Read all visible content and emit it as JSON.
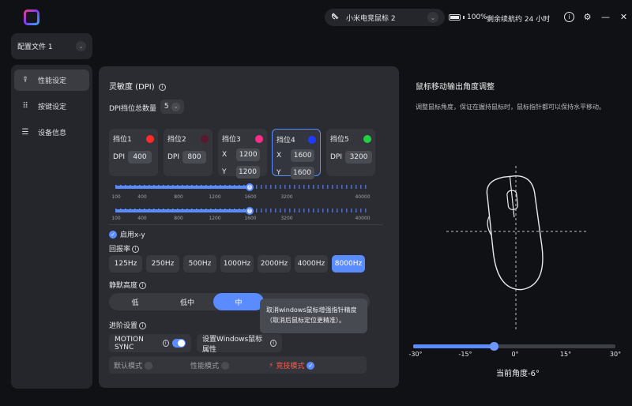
{
  "header": {
    "device_name": "小米电竞鼠标 2",
    "battery_pct": "100%",
    "battery_level": 1.0,
    "remaining": "剩余续航约 24 小时"
  },
  "profile": {
    "label": "配置文件 1"
  },
  "sidebar": {
    "items": [
      {
        "label": "性能设定",
        "icon": "performance-icon"
      },
      {
        "label": "按键设定",
        "icon": "keypad-icon"
      },
      {
        "label": "设备信息",
        "icon": "list-icon"
      }
    ]
  },
  "dpi": {
    "title": "灵敏度 (DPI)",
    "total_label": "DPI挡位总数量",
    "total": "5",
    "levels": [
      {
        "label": "挡位1",
        "color": "#ff2a2a",
        "mode": "single",
        "key": "DPI",
        "value": "400"
      },
      {
        "label": "挡位2",
        "color": "#5a1830",
        "mode": "single",
        "key": "DPI",
        "value": "800"
      },
      {
        "label": "挡位3",
        "color": "#ff2d8a",
        "mode": "xy",
        "x": "1200",
        "y": "1200"
      },
      {
        "label": "挡位4",
        "color": "#1f3bff",
        "mode": "xy",
        "x": "1600",
        "y": "1600",
        "selected": true
      },
      {
        "label": "挡位5",
        "color": "#20d040",
        "mode": "single",
        "key": "DPI",
        "value": "3200"
      }
    ],
    "x_label": "X",
    "y_label": "Y",
    "scale": [
      "100",
      "400",
      "800",
      "1200",
      "1600",
      "3200",
      "40000"
    ],
    "slider_x_mark": "X",
    "slider_y_mark": "Y",
    "enable_xy": "启用x-y"
  },
  "polling": {
    "title": "回报率",
    "options": [
      "125Hz",
      "250Hz",
      "500Hz",
      "1000Hz",
      "2000Hz",
      "4000Hz",
      "8000Hz"
    ],
    "selected": "8000Hz"
  },
  "lod": {
    "title": "静默高度",
    "options": [
      "低",
      "低中",
      "中"
    ],
    "selected": "中"
  },
  "tooltip": {
    "text": "取消windows鼠标增强指针精度（取消后鼠标定位更精准）。"
  },
  "advanced": {
    "title": "进阶设置",
    "motion_sync": "MOTION SYNC",
    "motion_sync_on": true,
    "windows_props": "设置Windows鼠标属性",
    "modes": [
      {
        "label": "默认模式",
        "checked": false
      },
      {
        "label": "性能模式",
        "checked": false
      },
      {
        "label": "竞技模式",
        "checked": true
      }
    ]
  },
  "angle": {
    "title": "鼠标移动输出角度调整",
    "desc": "调整鼠标角度，保证在握持鼠标时，鼠标指针都可以保持水平移动。",
    "scale": [
      "-30°",
      "-15°",
      "0°",
      "15°",
      "30°"
    ],
    "value": -6,
    "current_label": "当前角度-6°"
  }
}
